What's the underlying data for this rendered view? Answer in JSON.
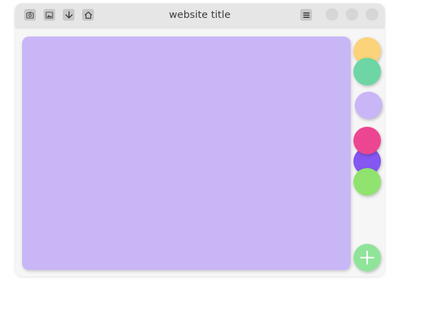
{
  "window": {
    "title": "website title"
  },
  "toolbar": {
    "buttons": [
      {
        "icon": "camera-icon"
      },
      {
        "icon": "image-icon"
      },
      {
        "icon": "download-icon"
      },
      {
        "icon": "home-icon"
      }
    ],
    "menu_icon": "menu-icon"
  },
  "colors": {
    "content_panel": "#c9b6f7",
    "circles": [
      "#fbd37a",
      "#6dd6a4",
      "#c9b6f7",
      "#ec4592",
      "#8457f0",
      "#8fe36e"
    ],
    "fab": "#8fe49a",
    "titlebar": "#e6e6e6",
    "window_dots": "#d6d6d6"
  },
  "fab": {
    "icon": "plus-icon"
  }
}
